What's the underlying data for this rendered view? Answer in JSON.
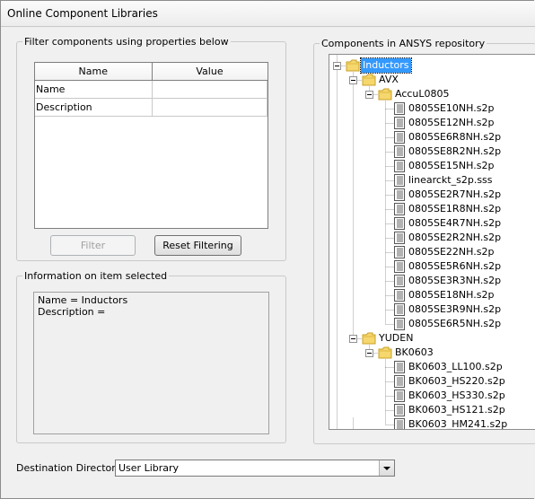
{
  "window": {
    "title": "Online Component Libraries"
  },
  "filter": {
    "legend": "Filter components using properties below",
    "columns": [
      "Name",
      "Value"
    ],
    "rows": [
      {
        "property": "Name",
        "value": ""
      },
      {
        "property": "Description",
        "value": ""
      }
    ],
    "filter_button": "Filter",
    "reset_button": "Reset Filtering"
  },
  "info": {
    "legend": "Information on item selected",
    "lines": [
      "Name = Inductors",
      "Description ="
    ]
  },
  "repository": {
    "legend": "Components in ANSYS repository",
    "nodes": [
      {
        "label": "Inductors",
        "type": "folder",
        "depth": 0,
        "expanded": true,
        "selected": true
      },
      {
        "label": "AVX",
        "type": "folder",
        "depth": 1,
        "expanded": true
      },
      {
        "label": "AccuL0805",
        "type": "folder",
        "depth": 2,
        "expanded": true
      },
      {
        "label": "0805SE10NH.s2p",
        "type": "file",
        "depth": 3
      },
      {
        "label": "0805SE12NH.s2p",
        "type": "file",
        "depth": 3
      },
      {
        "label": "0805SE6R8NH.s2p",
        "type": "file",
        "depth": 3
      },
      {
        "label": "0805SE8R2NH.s2p",
        "type": "file",
        "depth": 3
      },
      {
        "label": "0805SE15NH.s2p",
        "type": "file",
        "depth": 3
      },
      {
        "label": "linearckt_s2p.sss",
        "type": "file",
        "depth": 3
      },
      {
        "label": "0805SE2R7NH.s2p",
        "type": "file",
        "depth": 3
      },
      {
        "label": "0805SE1R8NH.s2p",
        "type": "file",
        "depth": 3
      },
      {
        "label": "0805SE4R7NH.s2p",
        "type": "file",
        "depth": 3
      },
      {
        "label": "0805SE2R2NH.s2p",
        "type": "file",
        "depth": 3
      },
      {
        "label": "0805SE22NH.s2p",
        "type": "file",
        "depth": 3
      },
      {
        "label": "0805SE5R6NH.s2p",
        "type": "file",
        "depth": 3
      },
      {
        "label": "0805SE3R3NH.s2p",
        "type": "file",
        "depth": 3
      },
      {
        "label": "0805SE18NH.s2p",
        "type": "file",
        "depth": 3
      },
      {
        "label": "0805SE3R9NH.s2p",
        "type": "file",
        "depth": 3
      },
      {
        "label": "0805SE6R5NH.s2p",
        "type": "file",
        "depth": 3
      },
      {
        "label": "YUDEN",
        "type": "folder",
        "depth": 1,
        "expanded": true
      },
      {
        "label": "BK0603",
        "type": "folder",
        "depth": 2,
        "expanded": true
      },
      {
        "label": "BK0603_LL100.s2p",
        "type": "file",
        "depth": 3
      },
      {
        "label": "BK0603_HS220.s2p",
        "type": "file",
        "depth": 3
      },
      {
        "label": "BK0603_HS330.s2p",
        "type": "file",
        "depth": 3
      },
      {
        "label": "BK0603_HS121.s2p",
        "type": "file",
        "depth": 3
      },
      {
        "label": "BK0603_HM241.s2p",
        "type": "file",
        "depth": 3
      }
    ]
  },
  "destination": {
    "label": "Destination Directory",
    "selected": "User Library"
  },
  "icons": {
    "folder": "folder-icon",
    "file": "file-icon",
    "expander": "collapse-icon",
    "dropdown": "chevron-down-icon"
  },
  "colors": {
    "selection": "#3399ff",
    "folder": "#f5d76e"
  }
}
